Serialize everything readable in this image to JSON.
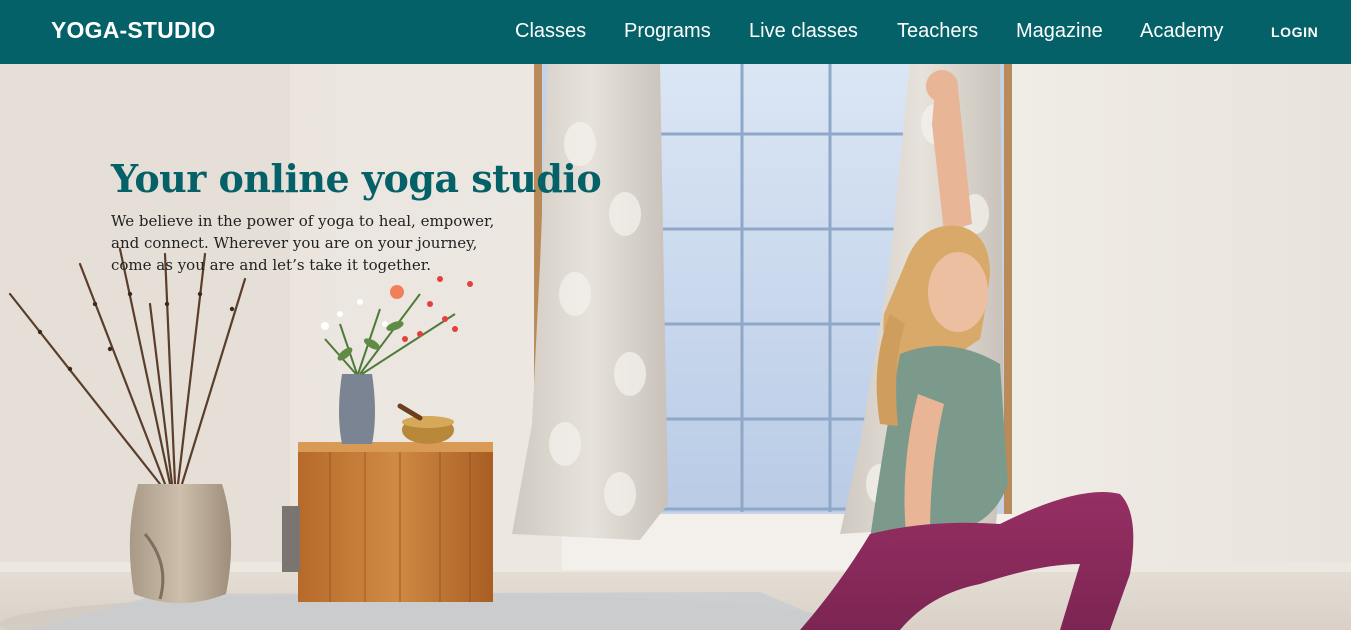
{
  "header": {
    "brand": "YOGA-STUDIO",
    "nav": [
      "Classes",
      "Programs",
      "Live classes",
      "Teachers",
      "Magazine",
      "Academy"
    ],
    "login": "LOGIN"
  },
  "hero": {
    "title": "Your online yoga studio",
    "text": "We believe in the power of yoga to heal, empower, and connect. Wherever you are on your journey, come as you are and let’s take it together."
  },
  "colors": {
    "brand_teal": "#046168",
    "wall": "#efebe5",
    "leggings": "#8b2a5c",
    "top": "#7c9a8c"
  }
}
